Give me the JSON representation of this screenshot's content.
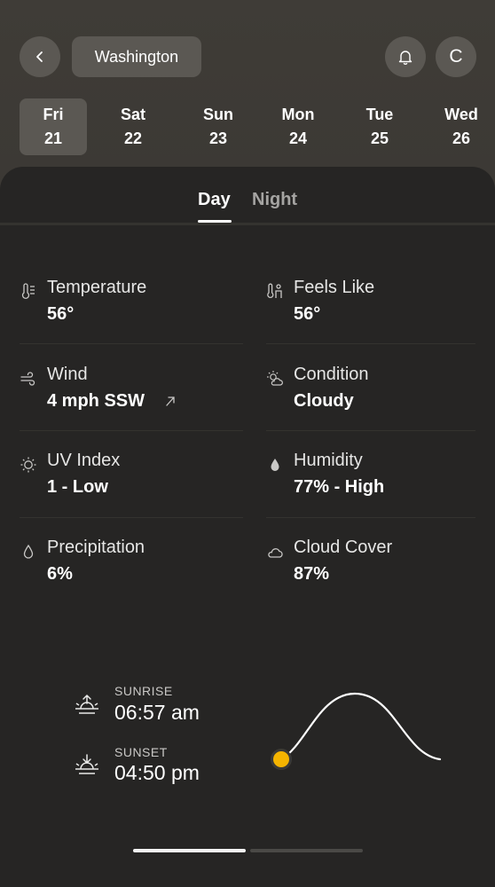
{
  "header": {
    "city": "Washington",
    "unit_label": "C",
    "back_icon": "chevron-left-icon",
    "bell_icon": "bell-icon"
  },
  "days": [
    {
      "name": "Fri",
      "date": "21",
      "selected": true
    },
    {
      "name": "Sat",
      "date": "22",
      "selected": false
    },
    {
      "name": "Sun",
      "date": "23",
      "selected": false
    },
    {
      "name": "Mon",
      "date": "24",
      "selected": false
    },
    {
      "name": "Tue",
      "date": "25",
      "selected": false
    },
    {
      "name": "Wed",
      "date": "26",
      "selected": false
    }
  ],
  "tabs": {
    "day": "Day",
    "night": "Night",
    "active": "day"
  },
  "metrics": {
    "temperature": {
      "label": "Temperature",
      "value": "56°",
      "icon": "thermometer-icon"
    },
    "feels_like": {
      "label": "Feels Like",
      "value": "56°",
      "icon": "feels-like-icon"
    },
    "wind": {
      "label": "Wind",
      "value": "4 mph SSW",
      "icon": "wind-icon",
      "direction_icon": "arrow-up-right-icon"
    },
    "condition": {
      "label": "Condition",
      "value": "Cloudy",
      "icon": "partly-cloudy-icon"
    },
    "uv_index": {
      "label": "UV Index",
      "value": "1 - Low",
      "icon": "sun-outline-icon"
    },
    "humidity": {
      "label": "Humidity",
      "value": "77% - High",
      "icon": "droplet-filled-icon"
    },
    "precipitation": {
      "label": "Precipitation",
      "value": "6%",
      "icon": "droplet-outline-icon"
    },
    "cloud_cover": {
      "label": "Cloud Cover",
      "value": "87%",
      "icon": "cloud-icon"
    }
  },
  "sun": {
    "sunrise_label": "SUNRISE",
    "sunrise_time": "06:57 am",
    "sunset_label": "SUNSET",
    "sunset_time": "04:50 pm",
    "sun_marker_color": "#f5b400"
  },
  "pager": {
    "pages": 2,
    "current": 1
  }
}
